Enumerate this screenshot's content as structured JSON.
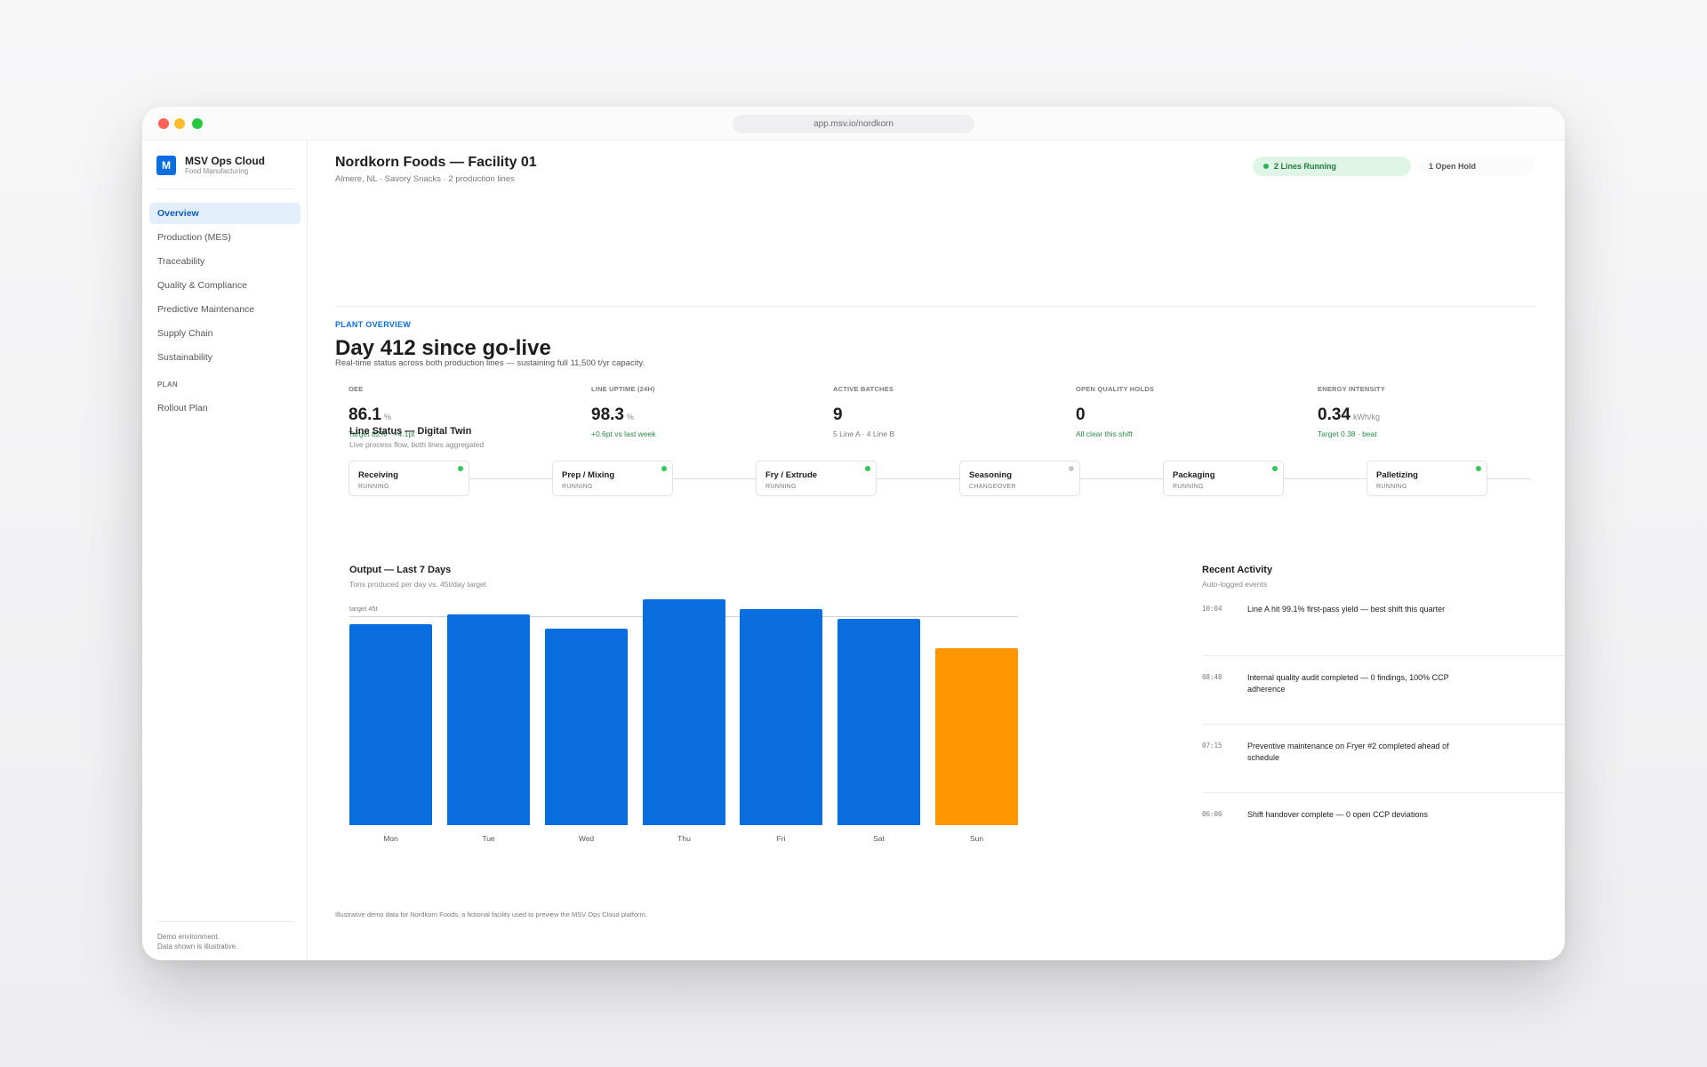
{
  "browser": {
    "url": "app.msv.io/nordkorn"
  },
  "sidebar": {
    "logo_letter": "M",
    "brand_name": "MSV Ops Cloud",
    "brand_sub": "Food Manufacturing",
    "items": [
      {
        "label": "Overview",
        "active": true
      },
      {
        "label": "Production (MES)"
      },
      {
        "label": "Traceability"
      },
      {
        "label": "Quality & Compliance"
      },
      {
        "label": "Predictive Maintenance"
      },
      {
        "label": "Supply Chain"
      },
      {
        "label": "Sustainability"
      }
    ],
    "section_plan": "PLAN",
    "plan_items": [
      {
        "label": "Rollout Plan"
      }
    ],
    "footer_line1": "Demo environment.",
    "footer_line2": "Data shown is illustrative."
  },
  "header": {
    "title": "Nordkorn Foods — Facility 01",
    "subtitle": "Almere, NL · Savory Snacks · 2 production lines",
    "status_running": "2 Lines Running",
    "status_hold": "1 Open Hold"
  },
  "overview": {
    "eyebrow": "PLANT OVERVIEW",
    "title": "Day 412 since go-live",
    "subtitle": "Real-time status across both production lines — sustaining full 11,500 t/yr capacity."
  },
  "kpis": [
    {
      "label": "OEE",
      "value": "86.1",
      "unit": "%",
      "note": "Target 82% · +4.1pt",
      "note_tone": "good"
    },
    {
      "label": "LINE UPTIME (24H)",
      "value": "98.3",
      "unit": "%",
      "note": "+0.6pt vs last week",
      "note_tone": "good"
    },
    {
      "label": "ACTIVE BATCHES",
      "value": "9",
      "unit": "",
      "note": "5 Line A · 4 Line B",
      "note_tone": "muted"
    },
    {
      "label": "OPEN QUALITY HOLDS",
      "value": "0",
      "unit": "",
      "note": "All clear this shift",
      "note_tone": "good"
    },
    {
      "label": "ENERGY INTENSITY",
      "value": "0.34",
      "unit": "kWh/kg",
      "note": "Target 0.38 · beat",
      "note_tone": "good"
    }
  ],
  "line_status": {
    "title": "Line Status — Digital Twin",
    "subtitle": "Live process flow, both lines aggregated",
    "stages": [
      {
        "name": "Receiving",
        "state": "RUNNING",
        "status_color": "#34c759"
      },
      {
        "name": "Prep / Mixing",
        "state": "RUNNING",
        "status_color": "#34c759"
      },
      {
        "name": "Fry / Extrude",
        "state": "RUNNING",
        "status_color": "#34c759"
      },
      {
        "name": "Seasoning",
        "state": "CHANGEOVER",
        "status_color": "#c7c7cc"
      },
      {
        "name": "Packaging",
        "state": "RUNNING",
        "status_color": "#34c759"
      },
      {
        "name": "Palletizing",
        "state": "RUNNING",
        "status_color": "#34c759"
      }
    ]
  },
  "output": {
    "title": "Output — Last 7 Days",
    "subtitle": "Tons produced per day vs. 45t/day target",
    "target_label": "target 45t"
  },
  "chart_data": {
    "type": "bar",
    "title": "Output — Last 7 Days",
    "categories": [
      "Mon",
      "Tue",
      "Wed",
      "Thu",
      "Fri",
      "Sat",
      "Sun"
    ],
    "values": [
      41,
      43,
      40,
      46,
      44,
      42,
      36
    ],
    "ylim": [
      0,
      46
    ],
    "target": 45,
    "colors": [
      "#0a6ee0",
      "#0a6ee0",
      "#0a6ee0",
      "#0a6ee0",
      "#0a6ee0",
      "#0a6ee0",
      "#ff9500"
    ]
  },
  "activity": {
    "title": "Recent Activity",
    "subtitle": "Auto-logged events",
    "items": [
      {
        "time": "10:04",
        "text": "Line A hit 99.1% first-pass yield — best shift this quarter"
      },
      {
        "time": "08:48",
        "text": "Internal quality audit completed — 0 findings, 100% CCP adherence"
      },
      {
        "time": "07:15",
        "text": "Preventive maintenance on Fryer #2 completed ahead of schedule"
      },
      {
        "time": "06:00",
        "text": "Shift handover complete — 0 open CCP deviations"
      }
    ]
  },
  "footnote": "Illustrative demo data for Nordkorn Foods, a fictional facility used to preview the MSV Ops Cloud platform."
}
